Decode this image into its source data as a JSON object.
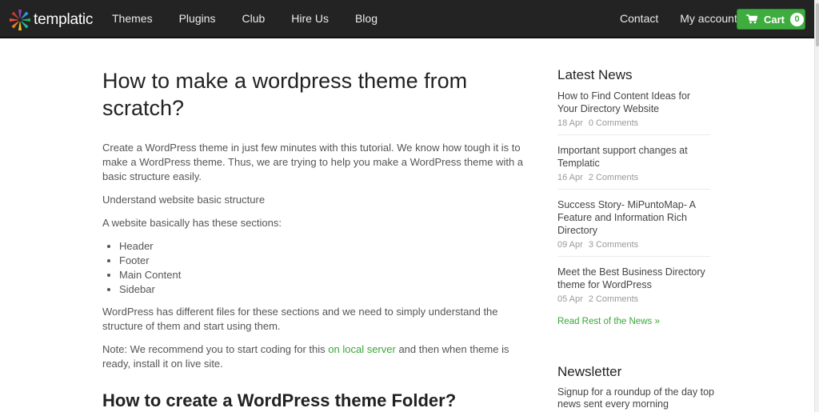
{
  "header": {
    "logo_text": "templatic",
    "nav_left": [
      "Themes",
      "Plugins",
      "Club",
      "Hire Us",
      "Blog"
    ],
    "nav_right": [
      "Contact",
      "My account"
    ],
    "cart": {
      "label": "Cart",
      "count": "0",
      "icon": "shopping-cart-icon"
    },
    "colors": {
      "bar": "#232323",
      "accent": "#3fac3f"
    }
  },
  "article": {
    "title": "How to make a wordpress theme from scratch?",
    "intro": "Create a WordPress theme in just few minutes with this tutorial. We know how tough it is to make a WordPress theme. Thus, we are trying to help you make a WordPress theme with a basic structure easily.",
    "p_structure": "Understand website basic structure",
    "p_sections": "A website basically has these sections:",
    "sections": [
      "Header",
      "Footer",
      "Main Content",
      "Sidebar"
    ],
    "p_files": "WordPress has different files for these sections and we need to simply understand the structure of them and start using them.",
    "note_before": "Note: We recommend you to start coding for this ",
    "note_link": "on local server",
    "note_after": " and then when theme is ready, install it on live site.",
    "subheading": "How to create a WordPress theme Folder?"
  },
  "sidebar": {
    "latest_news_title": "Latest News",
    "news": [
      {
        "title": "How to Find Content Ideas for Your Directory Website",
        "date": "18 Apr",
        "comments": "0 Comments"
      },
      {
        "title": "Important support changes at Templatic",
        "date": "16 Apr",
        "comments": "2 Comments"
      },
      {
        "title": "Success Story- MiPuntoMap- A Feature and Information Rich Directory",
        "date": "09 Apr",
        "comments": "3 Comments"
      },
      {
        "title": "Meet the Best Business Directory theme for WordPress",
        "date": "05 Apr",
        "comments": "2 Comments"
      }
    ],
    "read_more": "Read Rest of the News »",
    "newsletter_title": "Newsletter",
    "newsletter_text": "Signup for a roundup of the day top news sent every morning"
  }
}
